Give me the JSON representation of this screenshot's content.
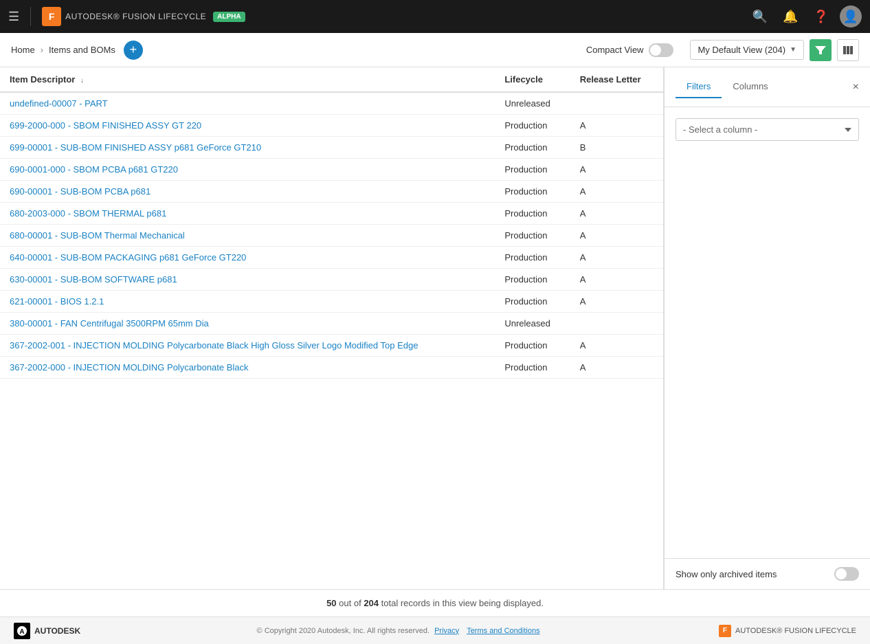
{
  "topnav": {
    "logo_text": "AUTODESK® FUSION LIFECYCLE",
    "alpha_badge": "ALPHA"
  },
  "breadcrumb": {
    "home": "Home",
    "separator": "›",
    "section": "Items and BOMs",
    "add_label": "+"
  },
  "toolbar": {
    "compact_view_label": "Compact View",
    "default_view_label": "My Default View (204)",
    "filter_icon": "▼",
    "columns_icon": "⊞"
  },
  "table": {
    "columns": [
      {
        "key": "item_descriptor",
        "label": "Item Descriptor",
        "sortable": true
      },
      {
        "key": "lifecycle",
        "label": "Lifecycle",
        "sortable": false
      },
      {
        "key": "release_letter",
        "label": "Release Letter",
        "sortable": false
      }
    ],
    "rows": [
      {
        "item": "undefined-00007 - PART",
        "lifecycle": "Unreleased",
        "release_letter": ""
      },
      {
        "item": "699-2000-000 - SBOM FINISHED ASSY GT 220",
        "lifecycle": "Production",
        "release_letter": "A"
      },
      {
        "item": "699-00001 - SUB-BOM FINISHED ASSY p681 GeForce GT210",
        "lifecycle": "Production",
        "release_letter": "B"
      },
      {
        "item": "690-0001-000 - SBOM PCBA p681 GT220",
        "lifecycle": "Production",
        "release_letter": "A"
      },
      {
        "item": "690-00001 - SUB-BOM PCBA p681",
        "lifecycle": "Production",
        "release_letter": "A"
      },
      {
        "item": "680-2003-000 - SBOM THERMAL p681",
        "lifecycle": "Production",
        "release_letter": "A"
      },
      {
        "item": "680-00001 - SUB-BOM Thermal Mechanical",
        "lifecycle": "Production",
        "release_letter": "A"
      },
      {
        "item": "640-00001 - SUB-BOM PACKAGING p681 GeForce GT220",
        "lifecycle": "Production",
        "release_letter": "A"
      },
      {
        "item": "630-00001 - SUB-BOM SOFTWARE p681",
        "lifecycle": "Production",
        "release_letter": "A"
      },
      {
        "item": "621-00001 - BIOS 1.2.1",
        "lifecycle": "Production",
        "release_letter": "A"
      },
      {
        "item": "380-00001 - FAN Centrifugal 3500RPM 65mm Dia",
        "lifecycle": "Unreleased",
        "release_letter": ""
      },
      {
        "item": "367-2002-001 - INJECTION MOLDING Polycarbonate Black High Gloss Silver Logo Modified Top Edge",
        "lifecycle": "Production",
        "release_letter": "A"
      },
      {
        "item": "367-2002-000 - INJECTION MOLDING Polycarbonate Black",
        "lifecycle": "Production",
        "release_letter": "A"
      }
    ]
  },
  "filter_panel": {
    "filters_tab": "Filters",
    "columns_tab": "Columns",
    "close_label": "×",
    "select_placeholder": "- Select a column -",
    "archived_label": "Show only archived items",
    "active_tab": "filters"
  },
  "status_bar": {
    "shown": "50",
    "out_of": "out of",
    "total": "204",
    "suffix": "total records in this view being displayed."
  },
  "footer": {
    "copyright": "© Copyright 2020 Autodesk, Inc. All rights reserved.",
    "privacy_link": "Privacy",
    "terms_link": "Terms and Conditions",
    "separator": "·",
    "brand_text": "AUTODESK® FUSION LIFECYCLE"
  }
}
